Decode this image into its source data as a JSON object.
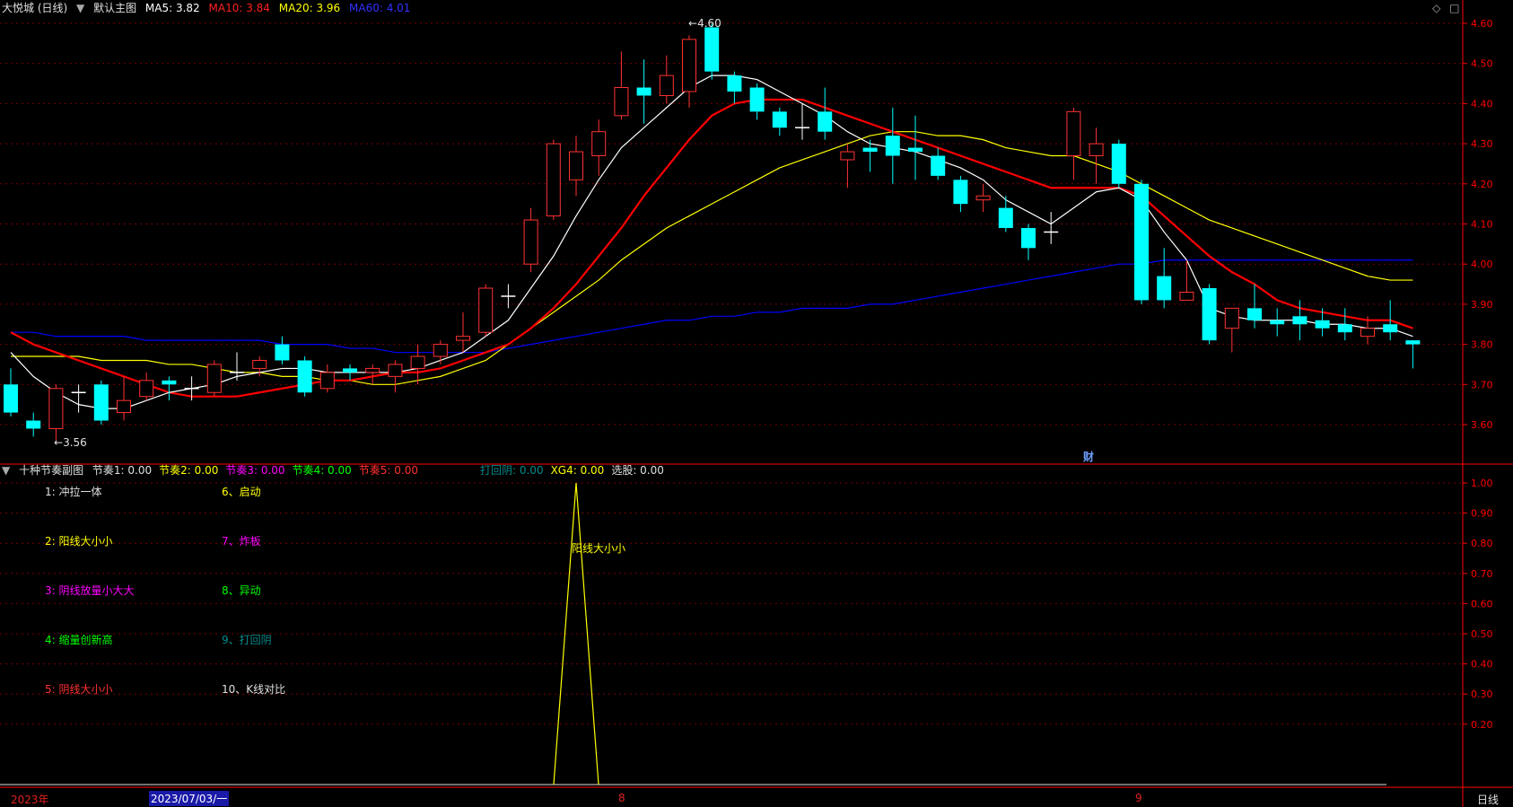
{
  "header": {
    "stock_name": "大悦城 (日线)",
    "main_chart_name": "默认主图",
    "ma5_label": "MA5: 3.82",
    "ma10_label": "MA10: 3.84",
    "ma20_label": "MA20: 3.96",
    "ma60_label": "MA60: 4.01"
  },
  "sub_header": {
    "name": "十种节奏副图",
    "items": [
      {
        "text": "节奏1: 0.00",
        "color": "#e0e0e0"
      },
      {
        "text": "节奏2: 0.00",
        "color": "#ffff00"
      },
      {
        "text": "节奏3: 0.00",
        "color": "#ff00ff"
      },
      {
        "text": "节奏4: 0.00",
        "color": "#00ff00"
      },
      {
        "text": "节奏5: 0.00",
        "color": "#ff3030"
      }
    ],
    "items2": [
      {
        "text": "打回阴: 0.00",
        "color": "#008b8b"
      },
      {
        "text": "XG4: 0.00",
        "color": "#ffff00"
      },
      {
        "text": "选股: 0.00",
        "color": "#e0e0e0"
      }
    ]
  },
  "legend_left": [
    {
      "text": "1: 冲拉一体",
      "color": "#e0e0e0"
    },
    {
      "text": "2: 阳线大小小",
      "color": "#ffff00"
    },
    {
      "text": "3: 阴线放量小大大",
      "color": "#ff00ff"
    },
    {
      "text": "4: 缩量创新高",
      "color": "#00ff00"
    },
    {
      "text": "5: 阴线大小小",
      "color": "#ff3030"
    }
  ],
  "legend_right": [
    {
      "text": "6、启动",
      "color": "#ffff00"
    },
    {
      "text": "7、炸板",
      "color": "#ff00ff"
    },
    {
      "text": "8、异动",
      "color": "#00ff00"
    },
    {
      "text": "9、打回阴",
      "color": "#008b8b"
    },
    {
      "text": "10、K线对比",
      "color": "#e0e0e0"
    }
  ],
  "annotations": {
    "high_label": "4.60",
    "low_label": "3.56",
    "fin_marker": "财",
    "signal_label": "阳线大小小"
  },
  "timeline": {
    "year_label": "2023年",
    "cursor_date": "2023/07/03/一",
    "month_aug": "8",
    "month_sep": "9",
    "period_button": "日线"
  },
  "colors": {
    "up": "#ff3232",
    "down": "#00ffff",
    "ma5": "#ffffff",
    "ma10": "#ff0000",
    "ma20": "#ffff00",
    "ma60": "#0000ff",
    "axis": "#ff0000",
    "signal": "#ffff00"
  },
  "chart_data": [
    {
      "type": "candlestick",
      "title": "大悦城 (日线)",
      "ylim": [
        3.52,
        4.64
      ],
      "yticks": [
        4.6,
        4.5,
        4.4,
        4.3,
        4.2,
        4.1,
        4.0,
        3.9,
        3.8,
        3.7,
        3.6
      ],
      "candles": [
        [
          3.7,
          3.63,
          3.74,
          3.62
        ],
        [
          3.61,
          3.59,
          3.63,
          3.57
        ],
        [
          3.59,
          3.69,
          3.7,
          3.56
        ],
        [
          3.68,
          3.68,
          3.7,
          3.63
        ],
        [
          3.7,
          3.61,
          3.71,
          3.6
        ],
        [
          3.63,
          3.66,
          3.72,
          3.61
        ],
        [
          3.67,
          3.71,
          3.73,
          3.66
        ],
        [
          3.71,
          3.7,
          3.72,
          3.66
        ],
        [
          3.69,
          3.69,
          3.72,
          3.66
        ],
        [
          3.68,
          3.75,
          3.76,
          3.67
        ],
        [
          3.73,
          3.73,
          3.78,
          3.71
        ],
        [
          3.74,
          3.76,
          3.77,
          3.72
        ],
        [
          3.8,
          3.76,
          3.82,
          3.75
        ],
        [
          3.76,
          3.68,
          3.77,
          3.67
        ],
        [
          3.69,
          3.73,
          3.75,
          3.68
        ],
        [
          3.74,
          3.73,
          3.75,
          3.71
        ],
        [
          3.73,
          3.74,
          3.75,
          3.7
        ],
        [
          3.72,
          3.75,
          3.76,
          3.68
        ],
        [
          3.74,
          3.77,
          3.8,
          3.7
        ],
        [
          3.77,
          3.8,
          3.81,
          3.75
        ],
        [
          3.81,
          3.82,
          3.88,
          3.78
        ],
        [
          3.83,
          3.94,
          3.95,
          3.82
        ],
        [
          3.92,
          3.92,
          3.95,
          3.89
        ],
        [
          4.0,
          4.11,
          4.14,
          3.98
        ],
        [
          4.12,
          4.3,
          4.31,
          4.11
        ],
        [
          4.21,
          4.28,
          4.32,
          4.17
        ],
        [
          4.27,
          4.33,
          4.36,
          4.22
        ],
        [
          4.37,
          4.44,
          4.53,
          4.36
        ],
        [
          4.44,
          4.42,
          4.51,
          4.35
        ],
        [
          4.42,
          4.47,
          4.52,
          4.4
        ],
        [
          4.43,
          4.56,
          4.57,
          4.39
        ],
        [
          4.59,
          4.48,
          4.6,
          4.46
        ],
        [
          4.47,
          4.43,
          4.48,
          4.4
        ],
        [
          4.44,
          4.38,
          4.45,
          4.36
        ],
        [
          4.38,
          4.34,
          4.39,
          4.32
        ],
        [
          4.34,
          4.34,
          4.4,
          4.31
        ],
        [
          4.38,
          4.33,
          4.44,
          4.31
        ],
        [
          4.26,
          4.28,
          4.3,
          4.19
        ],
        [
          4.29,
          4.28,
          4.31,
          4.23
        ],
        [
          4.32,
          4.27,
          4.39,
          4.2
        ],
        [
          4.29,
          4.28,
          4.37,
          4.21
        ],
        [
          4.27,
          4.22,
          4.29,
          4.21
        ],
        [
          4.21,
          4.15,
          4.22,
          4.13
        ],
        [
          4.16,
          4.17,
          4.2,
          4.13
        ],
        [
          4.14,
          4.09,
          4.17,
          4.08
        ],
        [
          4.09,
          4.04,
          4.1,
          4.01
        ],
        [
          4.08,
          4.08,
          4.13,
          4.05
        ],
        [
          4.27,
          4.38,
          4.39,
          4.21
        ],
        [
          4.27,
          4.3,
          4.34,
          4.2
        ],
        [
          4.3,
          4.2,
          4.31,
          4.19
        ],
        [
          4.2,
          3.91,
          4.21,
          3.9
        ],
        [
          3.97,
          3.91,
          4.04,
          3.89
        ],
        [
          3.91,
          3.93,
          4.01,
          3.91
        ],
        [
          3.94,
          3.81,
          3.95,
          3.8
        ],
        [
          3.84,
          3.89,
          3.89,
          3.78
        ],
        [
          3.89,
          3.86,
          3.95,
          3.84
        ],
        [
          3.86,
          3.85,
          3.89,
          3.82
        ],
        [
          3.87,
          3.85,
          3.91,
          3.81
        ],
        [
          3.86,
          3.84,
          3.89,
          3.82
        ],
        [
          3.85,
          3.83,
          3.89,
          3.81
        ],
        [
          3.82,
          3.84,
          3.87,
          3.8
        ],
        [
          3.85,
          3.83,
          3.91,
          3.81
        ],
        [
          3.81,
          3.8,
          3.81,
          3.74
        ]
      ],
      "ma5": [
        3.78,
        3.72,
        3.68,
        3.65,
        3.64,
        3.64,
        3.66,
        3.68,
        3.69,
        3.7,
        3.72,
        3.73,
        3.74,
        3.74,
        3.73,
        3.73,
        3.73,
        3.73,
        3.74,
        3.76,
        3.78,
        3.82,
        3.86,
        3.94,
        4.02,
        4.12,
        4.21,
        4.29,
        4.34,
        4.39,
        4.44,
        4.47,
        4.47,
        4.46,
        4.43,
        4.4,
        4.37,
        4.33,
        4.3,
        4.29,
        4.28,
        4.26,
        4.24,
        4.21,
        4.16,
        4.13,
        4.1,
        4.14,
        4.18,
        4.19,
        4.16,
        4.08,
        4.01,
        3.89,
        3.87,
        3.86,
        3.86,
        3.86,
        3.85,
        3.85,
        3.84,
        3.84,
        3.82
      ],
      "ma10": [
        3.83,
        3.8,
        3.78,
        3.76,
        3.74,
        3.72,
        3.7,
        3.68,
        3.67,
        3.67,
        3.67,
        3.68,
        3.69,
        3.7,
        3.71,
        3.71,
        3.72,
        3.73,
        3.73,
        3.74,
        3.76,
        3.78,
        3.8,
        3.84,
        3.89,
        3.95,
        4.02,
        4.09,
        4.17,
        4.24,
        4.31,
        4.37,
        4.4,
        4.41,
        4.41,
        4.41,
        4.39,
        4.37,
        4.35,
        4.33,
        4.31,
        4.29,
        4.27,
        4.25,
        4.23,
        4.21,
        4.19,
        4.19,
        4.19,
        4.19,
        4.17,
        4.12,
        4.07,
        4.02,
        3.98,
        3.95,
        3.91,
        3.89,
        3.88,
        3.87,
        3.86,
        3.86,
        3.84
      ],
      "ma20": [
        3.77,
        3.77,
        3.77,
        3.77,
        3.76,
        3.76,
        3.76,
        3.75,
        3.75,
        3.74,
        3.73,
        3.73,
        3.72,
        3.72,
        3.71,
        3.71,
        3.7,
        3.7,
        3.71,
        3.72,
        3.74,
        3.76,
        3.8,
        3.84,
        3.88,
        3.92,
        3.96,
        4.01,
        4.05,
        4.09,
        4.12,
        4.15,
        4.18,
        4.21,
        4.24,
        4.26,
        4.28,
        4.3,
        4.32,
        4.33,
        4.33,
        4.32,
        4.32,
        4.31,
        4.29,
        4.28,
        4.27,
        4.27,
        4.25,
        4.23,
        4.2,
        4.17,
        4.14,
        4.11,
        4.09,
        4.07,
        4.05,
        4.03,
        4.01,
        3.99,
        3.97,
        3.96,
        3.96
      ],
      "ma60": [
        3.83,
        3.83,
        3.82,
        3.82,
        3.82,
        3.82,
        3.81,
        3.81,
        3.81,
        3.81,
        3.81,
        3.81,
        3.8,
        3.8,
        3.8,
        3.79,
        3.79,
        3.78,
        3.78,
        3.78,
        3.78,
        3.78,
        3.79,
        3.8,
        3.81,
        3.82,
        3.83,
        3.84,
        3.85,
        3.86,
        3.86,
        3.87,
        3.87,
        3.88,
        3.88,
        3.89,
        3.89,
        3.89,
        3.9,
        3.9,
        3.91,
        3.92,
        3.93,
        3.94,
        3.95,
        3.96,
        3.97,
        3.98,
        3.99,
        4.0,
        4.0,
        4.01,
        4.01,
        4.01,
        4.01,
        4.01,
        4.01,
        4.01,
        4.01,
        4.01,
        4.01,
        4.01,
        4.01
      ]
    },
    {
      "type": "line",
      "title": "十种节奏副图",
      "ylim": [
        0,
        1.08
      ],
      "yticks": [
        1.0,
        0.9,
        0.8,
        0.7,
        0.6,
        0.5,
        0.4,
        0.3,
        0.2
      ],
      "series": [
        {
          "name": "XG4",
          "peak_index": 25,
          "peak_value": 1.0
        }
      ]
    }
  ]
}
